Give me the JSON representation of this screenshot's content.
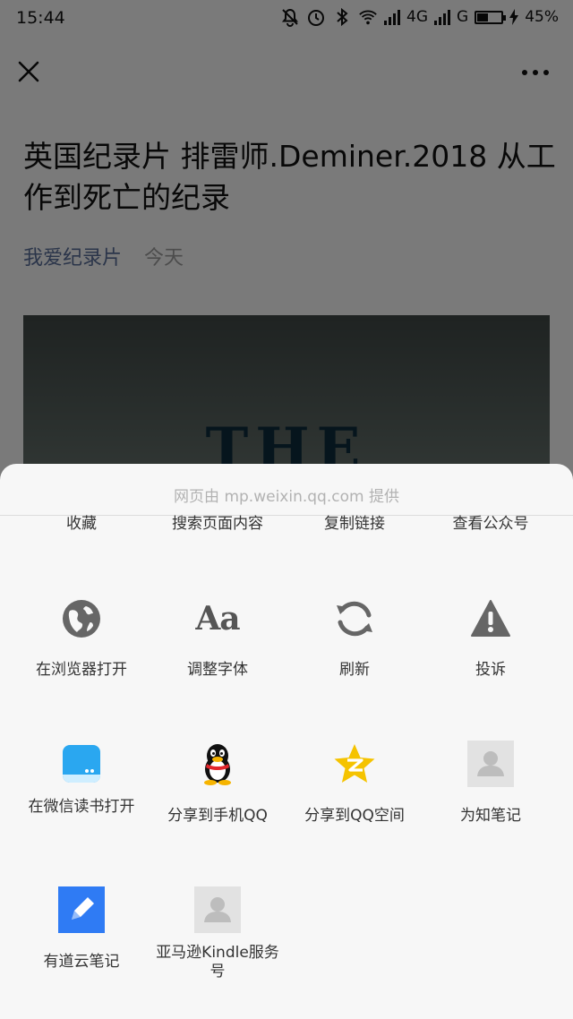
{
  "status_bar": {
    "time": "15:44",
    "network_1": "4G",
    "network_2": "G",
    "battery_percent": "45%",
    "battery_level": 0.45
  },
  "article": {
    "title": "英国纪录片 排雷师.Deminer.2018 从工作到死亡的纪录",
    "account": "我爱纪录片",
    "date": "今天",
    "cover_text": "THE DEMINER"
  },
  "sheet": {
    "provider": "网页由 mp.weixin.qq.com 提供",
    "row0": [
      "收藏",
      "搜索页面内容",
      "复制链接",
      "查看公众号"
    ],
    "row1": [
      {
        "label": "在浏览器打开",
        "icon": "globe-icon"
      },
      {
        "label": "调整字体",
        "icon": "font-size-icon",
        "glyph": "Aa"
      },
      {
        "label": "刷新",
        "icon": "refresh-icon"
      },
      {
        "label": "投诉",
        "icon": "warning-icon"
      }
    ],
    "row2": [
      {
        "label": "在微信读书打开",
        "icon": "weread-icon"
      },
      {
        "label": "分享到手机QQ",
        "icon": "qq-penguin-icon"
      },
      {
        "label": "分享到QQ空间",
        "icon": "qzone-star-icon"
      },
      {
        "label": "为知笔记",
        "icon": "placeholder-avatar-icon"
      }
    ],
    "row3": [
      {
        "label": "有道云笔记",
        "icon": "youdao-note-icon"
      },
      {
        "label": "亚马逊Kindle服务号",
        "icon": "placeholder-avatar-icon"
      }
    ]
  },
  "colors": {
    "account_link": "#576b95",
    "weread_blue": "#2aa7f0",
    "youdao_blue": "#2f7bf4",
    "qzone_yellow": "#f5c300"
  }
}
